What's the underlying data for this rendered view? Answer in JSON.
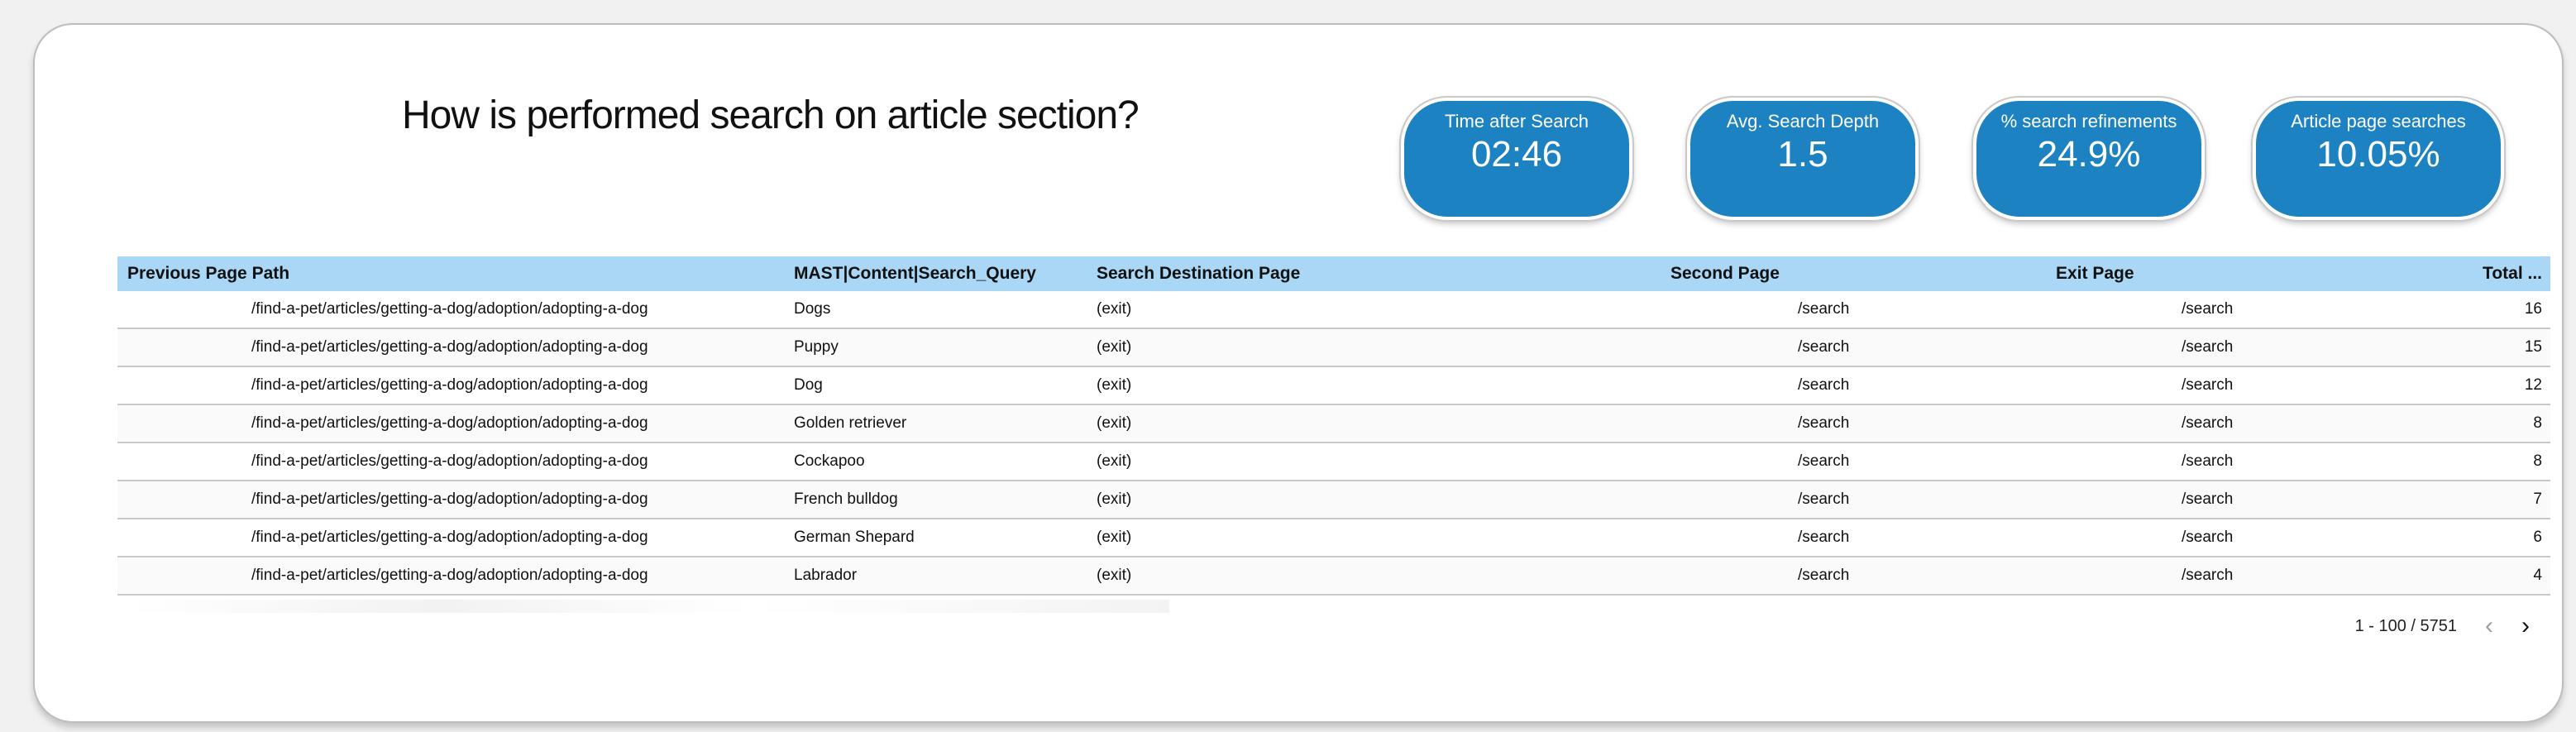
{
  "dashboard": {
    "title": "How is performed search on article section?"
  },
  "kpis": [
    {
      "label": "Time after Search",
      "value": "02:46"
    },
    {
      "label": "Avg. Search Depth",
      "value": "1.5"
    },
    {
      "label": "% search refinements",
      "value": "24.9%"
    },
    {
      "label": "Article page searches",
      "value": "10.05%"
    }
  ],
  "table": {
    "headers": [
      "Previous Page Path",
      "MAST|Content|Search_Query",
      "Search Destination Page",
      "Second Page",
      "Exit Page",
      "Total ..."
    ],
    "rows": [
      {
        "prev": "/find-a-pet/articles/getting-a-dog/adoption/adopting-a-dog",
        "query": "Dogs",
        "dest": "(exit)",
        "second": "/search",
        "exit": "/search",
        "total": "16"
      },
      {
        "prev": "/find-a-pet/articles/getting-a-dog/adoption/adopting-a-dog",
        "query": "Puppy",
        "dest": "(exit)",
        "second": "/search",
        "exit": "/search",
        "total": "15"
      },
      {
        "prev": "/find-a-pet/articles/getting-a-dog/adoption/adopting-a-dog",
        "query": "Dog",
        "dest": "(exit)",
        "second": "/search",
        "exit": "/search",
        "total": "12"
      },
      {
        "prev": "/find-a-pet/articles/getting-a-dog/adoption/adopting-a-dog",
        "query": "Golden retriever",
        "dest": "(exit)",
        "second": "/search",
        "exit": "/search",
        "total": "8"
      },
      {
        "prev": "/find-a-pet/articles/getting-a-dog/adoption/adopting-a-dog",
        "query": "Cockapoo",
        "dest": "(exit)",
        "second": "/search",
        "exit": "/search",
        "total": "8"
      },
      {
        "prev": "/find-a-pet/articles/getting-a-dog/adoption/adopting-a-dog",
        "query": "French bulldog",
        "dest": "(exit)",
        "second": "/search",
        "exit": "/search",
        "total": "7"
      },
      {
        "prev": "/find-a-pet/articles/getting-a-dog/adoption/adopting-a-dog",
        "query": "German Shepard",
        "dest": "(exit)",
        "second": "/search",
        "exit": "/search",
        "total": "6"
      },
      {
        "prev": "/find-a-pet/articles/getting-a-dog/adoption/adopting-a-dog",
        "query": "Labrador",
        "dest": "(exit)",
        "second": "/search",
        "exit": "/search",
        "total": "4"
      }
    ]
  },
  "pagination": {
    "range": "1 - 100 / 5751",
    "prev_icon": "chevron-left-icon",
    "next_icon": "chevron-right-icon"
  },
  "colors": {
    "kpi_bg": "#1c82c2",
    "header_bg": "#a9d7f5"
  }
}
